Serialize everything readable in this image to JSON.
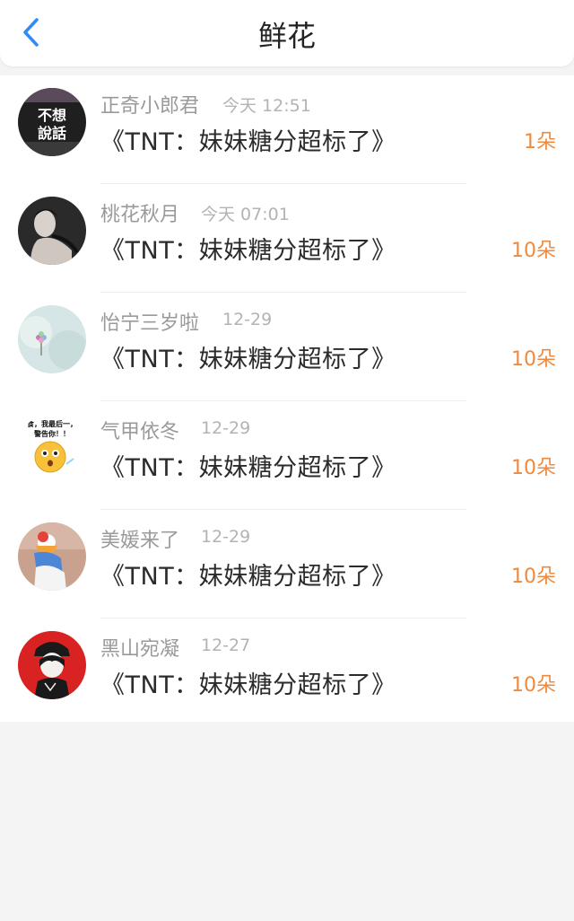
{
  "header": {
    "title": "鲜花",
    "back_icon": "chevron-left-icon",
    "accent_color": "#2f8bf5"
  },
  "flower_list": [
    {
      "name": "正奇小郎君",
      "time": "今天 12:51",
      "book": "《TNT：妹妹糖分超标了》",
      "count": "1朵",
      "avatar_text": [
        "不想",
        "說話"
      ]
    },
    {
      "name": "桃花秋月",
      "time": "今天 07:01",
      "book": "《TNT：妹妹糖分超标了》",
      "count": "10朵"
    },
    {
      "name": "怡宁三岁啦",
      "time": "12-29",
      "book": "《TNT：妹妹糖分超标了》",
      "count": "10朵"
    },
    {
      "name": "气甲依冬",
      "time": "12-29",
      "book": "《TNT：妹妹糖分超标了》",
      "count": "10朵",
      "avatar_text": [
        "食，我最后一，",
        "警告你！！"
      ]
    },
    {
      "name": "美媛来了",
      "time": "12-29",
      "book": "《TNT：妹妹糖分超标了》",
      "count": "10朵"
    },
    {
      "name": "黑山宛凝",
      "time": "12-27",
      "book": "《TNT：妹妹糖分超标了》",
      "count": "10朵"
    }
  ],
  "colors": {
    "count": "#ee8a3e",
    "name": "#9a9a9a",
    "time": "#b3b3b3",
    "book": "#2b2b2b"
  }
}
